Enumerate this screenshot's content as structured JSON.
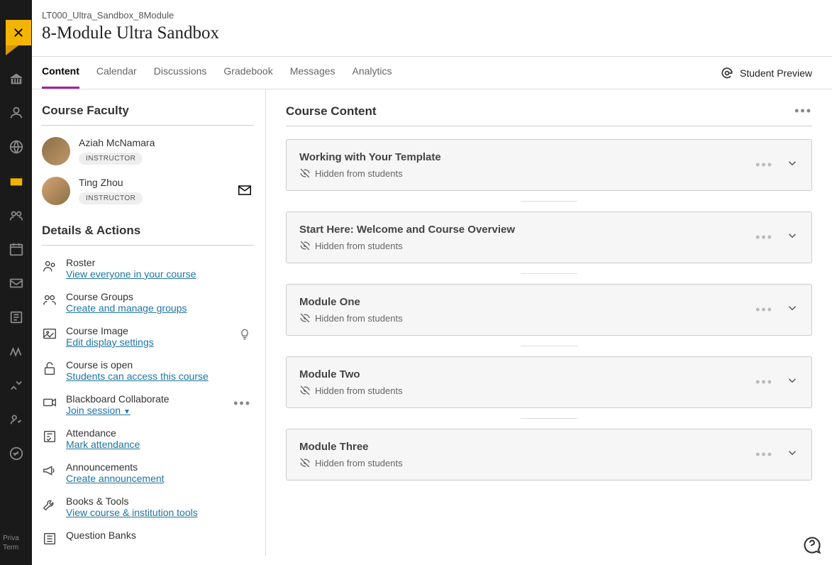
{
  "course_code": "LT000_Ultra_Sandbox_8Module",
  "course_title": "8-Module Ultra Sandbox",
  "tabs": [
    "Content",
    "Calendar",
    "Discussions",
    "Gradebook",
    "Messages",
    "Analytics"
  ],
  "student_preview": "Student Preview",
  "faculty_heading": "Course Faculty",
  "faculty": [
    {
      "name": "Aziah McNamara",
      "role": "INSTRUCTOR"
    },
    {
      "name": "Ting Zhou",
      "role": "INSTRUCTOR"
    }
  ],
  "details_heading": "Details & Actions",
  "actions": {
    "roster": {
      "label": "Roster",
      "link": "View everyone in your course"
    },
    "groups": {
      "label": "Course Groups",
      "link": "Create and manage groups"
    },
    "image": {
      "label": "Course Image",
      "link": "Edit display settings"
    },
    "open": {
      "label": "Course is open",
      "link": "Students can access this course"
    },
    "collab": {
      "label": "Blackboard Collaborate",
      "link": "Join session"
    },
    "attendance": {
      "label": "Attendance",
      "link": "Mark attendance"
    },
    "announce": {
      "label": "Announcements",
      "link": "Create announcement"
    },
    "books": {
      "label": "Books & Tools",
      "link": "View course & institution tools"
    },
    "banks": {
      "label": "Question Banks"
    }
  },
  "content_heading": "Course Content",
  "hidden_text": "Hidden from students",
  "modules": [
    "Working with Your Template",
    "Start Here: Welcome and Course Overview",
    "Module One",
    "Module Two",
    "Module Three"
  ],
  "footer": {
    "privacy": "Priva",
    "terms": "Term"
  }
}
